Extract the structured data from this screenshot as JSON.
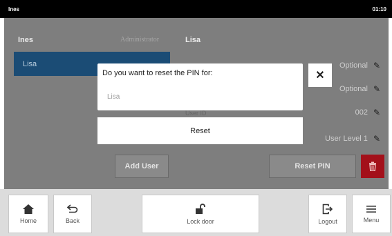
{
  "statusbar": {
    "user": "Ines",
    "time": "01:10"
  },
  "users": {
    "header_name": "Ines",
    "header_role": "Administrator",
    "selected": "Lisa",
    "add_user_label": "Add User"
  },
  "details": {
    "name": "Lisa",
    "rows": [
      {
        "value": "Optional"
      },
      {
        "value": "Optional"
      },
      {
        "label": "User ID",
        "value": "002"
      },
      {
        "value": "User Level 1"
      }
    ],
    "reset_pin_label": "Reset PIN"
  },
  "dialog": {
    "prompt": "Do you want to reset the PIN for:",
    "target": "Lisa",
    "close_glyph": "✕",
    "reset_label": "Reset"
  },
  "toolbar": {
    "home": "Home",
    "back": "Back",
    "lock": "Lock door",
    "logout": "Logout",
    "menu": "Menu"
  },
  "colors": {
    "selection": "#1b4c75",
    "delete": "#a3101a",
    "overlay": "#7e7e7e"
  },
  "icons": [
    "home-icon",
    "back-arrow-icon",
    "unlock-icon",
    "logout-icon",
    "menu-icon",
    "pencil-icon",
    "trash-icon",
    "close-icon"
  ]
}
